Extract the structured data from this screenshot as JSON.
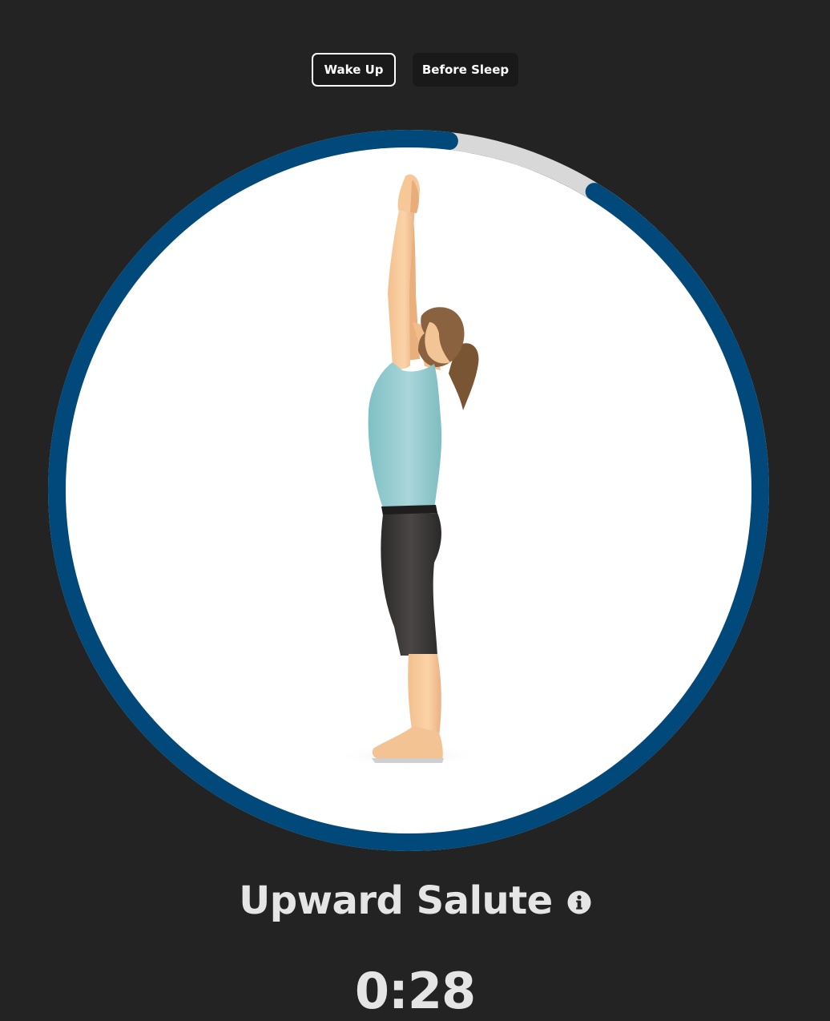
{
  "tabs": [
    {
      "label": "Wake Up",
      "active": true
    },
    {
      "label": "Before Sleep",
      "active": false
    }
  ],
  "pose": {
    "name": "Upward Salute",
    "info_icon": "info-icon"
  },
  "timer": {
    "value": "0:28"
  },
  "progress": {
    "remaining_fraction": 0.93
  },
  "colors": {
    "background": "#232323",
    "progress": "#00497A",
    "track": "#D8D8D8",
    "circle": "#FFFFFF",
    "text": "#E5E5E5"
  }
}
